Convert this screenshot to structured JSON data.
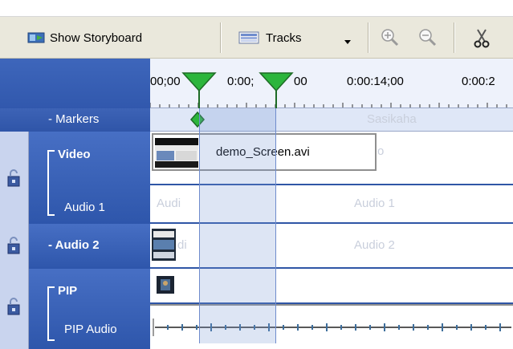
{
  "toolbar": {
    "show_storyboard_label": "Show Storyboard",
    "tracks_label": "Tracks",
    "icons": [
      "storyboard-icon",
      "tracks-icon",
      "dropdown-arrow-icon",
      "zoom-in-icon",
      "zoom-out-icon",
      "scissors-icon"
    ]
  },
  "ruler": {
    "times": [
      "00;00",
      "0:00;",
      "00",
      "0:00:14;00",
      "0:00:2"
    ]
  },
  "tracks": {
    "markers_label": "- Markers",
    "markers_ghost": "Sasikaha",
    "video_label": "Video",
    "audio1_label": "Audio 1",
    "audio2_label": "- Audio 2",
    "pip_label": "PIP",
    "pip_audio_label": "PIP Audio"
  },
  "clips": {
    "video_clip_name": "demo_Screen.avi",
    "video_ghost": "o",
    "audio1_ghost_left": "Audi",
    "audio1_ghost_center": "Audio 1",
    "audio2_ghost_left": "di",
    "audio2_ghost_center": "Audio 2"
  },
  "colors": {
    "track_header_blue": "#3a62b8",
    "playhead_green": "#2aa83a",
    "selection_band": "#b9c9ee"
  }
}
